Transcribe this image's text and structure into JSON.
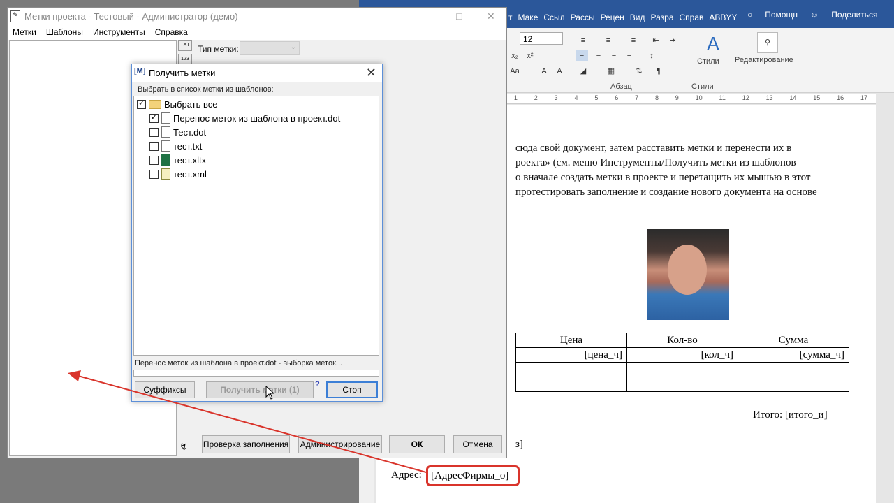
{
  "word": {
    "tabs": [
      "т",
      "Маке",
      "Ссыл",
      "Рассы",
      "Рецен",
      "Вид",
      "Разра",
      "Справ",
      "ABBYY"
    ],
    "help": "Помощн",
    "share": "Поделиться",
    "font_size": "12",
    "group_paragraph": "Абзац",
    "group_styles": "Стили",
    "styles_label": "Стили",
    "editing_label": "Редактирование",
    "ruler": [
      "1",
      "2",
      "3",
      "4",
      "5",
      "6",
      "7",
      "8",
      "9",
      "10",
      "11",
      "12",
      "13",
      "14",
      "15",
      "16",
      "17"
    ],
    "doc_lines": [
      "сюда свой документ, затем расставить метки и перенести их в",
      "роекта» (см. меню Инструменты/Получить метки из шаблонов",
      "о вначале создать метки в проекте и перетащить их мышью в этот",
      "протестировать заполнение и создание нового документа на основе"
    ],
    "table": {
      "headers": [
        "Цена",
        "Кол-во",
        "Сумма"
      ],
      "row1": [
        "[цена_ч]",
        "[кол_ч]",
        "[сумма_ч]"
      ]
    },
    "total": "Итого: [итого_и]",
    "sign_fragment": "з]",
    "address_label": "Адрес:",
    "address_tag": "[АдресФирмы_о]"
  },
  "main_window": {
    "title": "Метки проекта - Тестовый - Администратор (демо)",
    "menu": [
      "Метки",
      "Шаблоны",
      "Инструменты",
      "Справка"
    ],
    "tools": [
      "TXT",
      "123"
    ],
    "tag_type_label": "Тип метки:",
    "buttons": {
      "check_fill": "Проверка заполнения",
      "admin": "Администрирование",
      "ok": "ОК",
      "cancel": "Отмена"
    }
  },
  "dialog": {
    "icon": "[M]",
    "title": "Получить метки",
    "hint": "Выбрать в список метки из шаблонов:",
    "select_all": "Выбрать все",
    "items": [
      {
        "name": "Перенос меток из шаблона в проект.dot",
        "checked": true,
        "icon": "doc"
      },
      {
        "name": "Тест.dot",
        "checked": false,
        "icon": "doc"
      },
      {
        "name": "тест.txt",
        "checked": false,
        "icon": "txt"
      },
      {
        "name": "тест.xltx",
        "checked": false,
        "icon": "xl"
      },
      {
        "name": "тест.xml",
        "checked": false,
        "icon": "xml"
      }
    ],
    "status": "Перенос меток из шаблона в проект.dot - выборка меток...",
    "help_mark": "?",
    "buttons": {
      "suffixes": "Суффиксы",
      "get_tags": "Получить метки (1)",
      "stop": "Стоп"
    }
  },
  "colors": {
    "word_blue": "#2b579a",
    "annotation_red": "#d9342b",
    "dialog_border": "#5c8fd8"
  }
}
